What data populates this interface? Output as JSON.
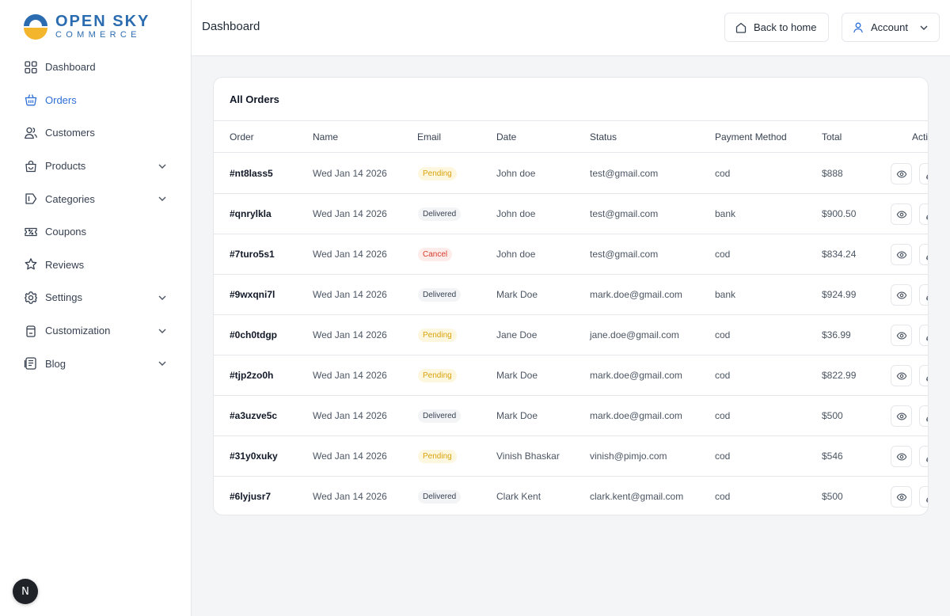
{
  "brand": {
    "line1": "OPEN SKY",
    "line2": "COMMERCE"
  },
  "sidebar": {
    "items": [
      {
        "label": "Dashboard",
        "icon": "grid-icon",
        "expandable": false,
        "active": false
      },
      {
        "label": "Orders",
        "icon": "basket-icon",
        "expandable": false,
        "active": true
      },
      {
        "label": "Customers",
        "icon": "users-icon",
        "expandable": false,
        "active": false
      },
      {
        "label": "Products",
        "icon": "bag-icon",
        "expandable": true,
        "active": false
      },
      {
        "label": "Categories",
        "icon": "tag-icon",
        "expandable": true,
        "active": false
      },
      {
        "label": "Coupons",
        "icon": "ticket-icon",
        "expandable": false,
        "active": false
      },
      {
        "label": "Reviews",
        "icon": "star-badge-icon",
        "expandable": false,
        "active": false
      },
      {
        "label": "Settings",
        "icon": "gear-icon",
        "expandable": true,
        "active": false
      },
      {
        "label": "Customization",
        "icon": "palette-icon",
        "expandable": true,
        "active": false
      },
      {
        "label": "Blog",
        "icon": "document-icon",
        "expandable": true,
        "active": false
      }
    ]
  },
  "next_badge": "N",
  "header": {
    "title": "Dashboard",
    "back_home": "Back to home",
    "account": "Account"
  },
  "orders": {
    "title": "All Orders",
    "columns": [
      "Order",
      "Name",
      "Email",
      "Date",
      "Status",
      "Payment Method",
      "Total",
      "Acti"
    ],
    "rows": [
      {
        "order": "#nt8lass5",
        "name": "Wed Jan 14 2026",
        "email": "Pending",
        "date": "John doe",
        "status": "test@gmail.com",
        "payment": "cod",
        "total": "$888"
      },
      {
        "order": "#qnrylkla",
        "name": "Wed Jan 14 2026",
        "email": "Delivered",
        "date": "John doe",
        "status": "test@gmail.com",
        "payment": "bank",
        "total": "$900.50"
      },
      {
        "order": "#7turo5s1",
        "name": "Wed Jan 14 2026",
        "email": "Cancel",
        "date": "John doe",
        "status": "test@gmail.com",
        "payment": "cod",
        "total": "$834.24"
      },
      {
        "order": "#9wxqni7l",
        "name": "Wed Jan 14 2026",
        "email": "Delivered",
        "date": "Mark Doe",
        "status": "mark.doe@gmail.com",
        "payment": "bank",
        "total": "$924.99"
      },
      {
        "order": "#0ch0tdgp",
        "name": "Wed Jan 14 2026",
        "email": "Pending",
        "date": "Jane Doe",
        "status": "jane.doe@gmail.com",
        "payment": "cod",
        "total": "$36.99"
      },
      {
        "order": "#tjp2zo0h",
        "name": "Wed Jan 14 2026",
        "email": "Pending",
        "date": "Mark Doe",
        "status": "mark.doe@gmail.com",
        "payment": "cod",
        "total": "$822.99"
      },
      {
        "order": "#a3uzve5c",
        "name": "Wed Jan 14 2026",
        "email": "Delivered",
        "date": "Mark Doe",
        "status": "mark.doe@gmail.com",
        "payment": "cod",
        "total": "$500"
      },
      {
        "order": "#31y0xuky",
        "name": "Wed Jan 14 2026",
        "email": "Pending",
        "date": "Vinish Bhaskar",
        "status": "vinish@pimjo.com",
        "payment": "cod",
        "total": "$546"
      },
      {
        "order": "#6lyjusr7",
        "name": "Wed Jan 14 2026",
        "email": "Delivered",
        "date": "Clark Kent",
        "status": "clark.kent@gmail.com",
        "payment": "cod",
        "total": "$500"
      }
    ]
  },
  "colors": {
    "brand_blue": "#2b6cb0",
    "brand_yellow": "#f2b52c",
    "active_nav": "#2f6fd6",
    "pending": "#d9a20b",
    "cancel": "#d93a2b"
  }
}
